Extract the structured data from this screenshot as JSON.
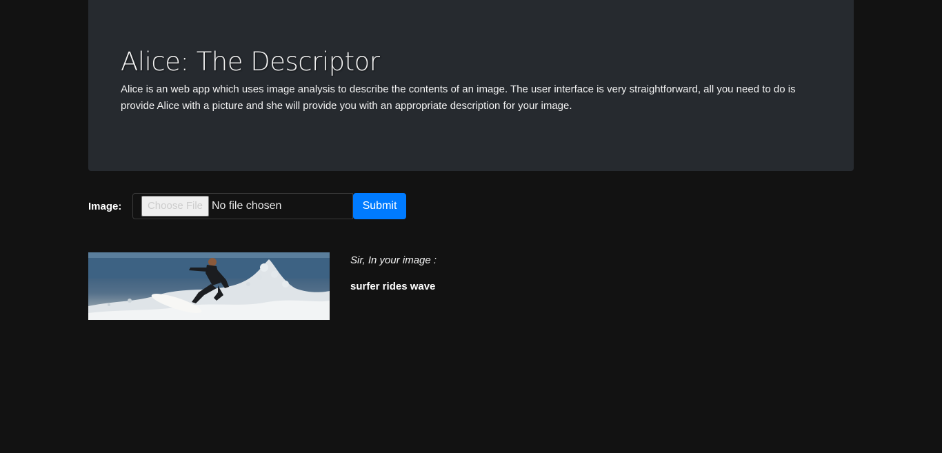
{
  "header": {
    "title": "Alice: The Descriptor",
    "description": "Alice is an web app which uses image analysis to describe the contents of an image. The user interface is very straightforward, all you need to do is provide Alice with a picture and she will provide you with an appropriate description for your image."
  },
  "form": {
    "label": "Image:",
    "choose_file": "Choose File",
    "no_file": "No file chosen",
    "submit": "Submit"
  },
  "result": {
    "intro": "Sir, In your image :",
    "description": "surfer rides wave"
  },
  "colors": {
    "background": "#121212",
    "jumbotron": "#262a2f",
    "submit": "#007bff"
  }
}
